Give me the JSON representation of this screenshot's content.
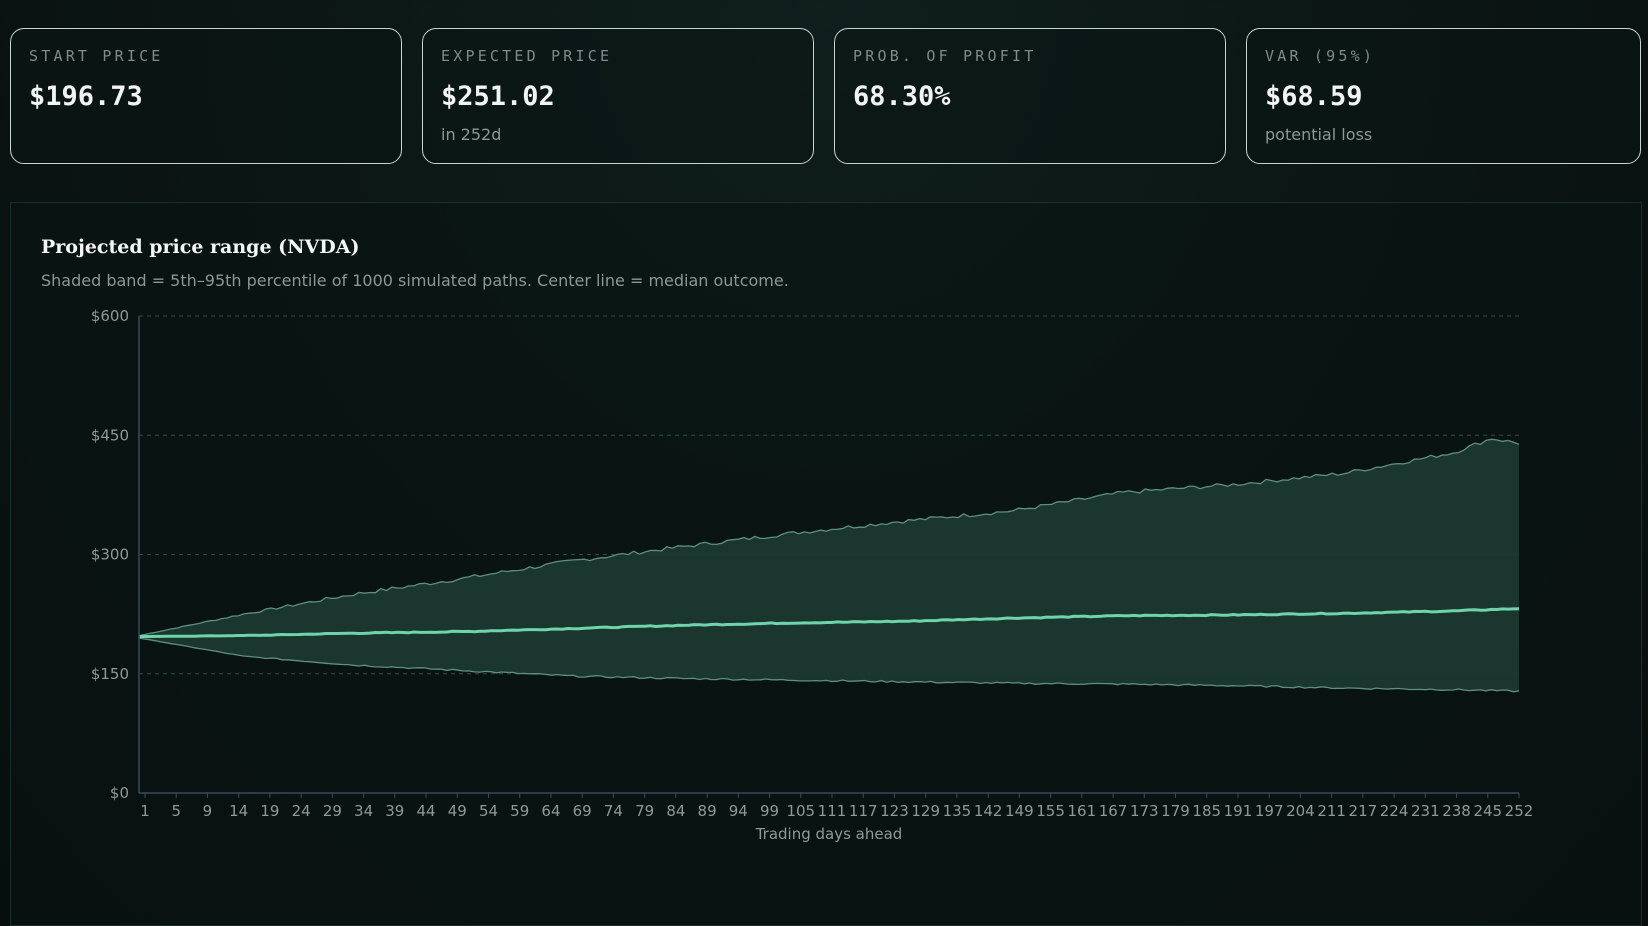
{
  "stats": [
    {
      "label": "START PRICE",
      "value": "$196.73",
      "sub": ""
    },
    {
      "label": "EXPECTED PRICE",
      "value": "$251.02",
      "sub": "in 252d"
    },
    {
      "label": "PROB. OF PROFIT",
      "value": "68.30%",
      "sub": ""
    },
    {
      "label": "VAR (95%)",
      "value": "$68.59",
      "sub": "potential loss"
    }
  ],
  "colors": {
    "band_fill": "#1c3a32",
    "band_edge": "#5e8f80",
    "median": "#6fd3ac",
    "grid": "#2e4a50",
    "axis": "#3a4a5a"
  },
  "chart_data": {
    "type": "area",
    "title": "Projected price range (NVDA)",
    "subtitle": "Shaded band = 5th–95th percentile of 1000 simulated paths. Center line = median outcome.",
    "xlabel": "Trading days ahead",
    "ylabel": "",
    "ylim": [
      0,
      600
    ],
    "y_ticks": [
      0,
      150,
      300,
      450,
      600
    ],
    "y_tick_labels": [
      "$0",
      "$150",
      "$300",
      "$450",
      "$600"
    ],
    "x_tick_labels": [
      "1",
      "5",
      "9",
      "14",
      "19",
      "24",
      "29",
      "34",
      "39",
      "44",
      "49",
      "54",
      "59",
      "64",
      "69",
      "74",
      "79",
      "84",
      "89",
      "94",
      "99",
      "105",
      "111",
      "117",
      "123",
      "129",
      "135",
      "142",
      "149",
      "155",
      "161",
      "167",
      "173",
      "179",
      "185",
      "191",
      "197",
      "204",
      "211",
      "217",
      "224",
      "231",
      "238",
      "245",
      "252"
    ],
    "xlim": [
      1,
      252
    ],
    "grid": true,
    "series": [
      {
        "name": "95th percentile",
        "x": [
          1,
          20,
          40,
          60,
          80,
          100,
          120,
          140,
          160,
          180,
          200,
          220,
          240,
          247,
          252
        ],
        "values": [
          198,
          225,
          250,
          270,
          292,
          310,
          327,
          342,
          355,
          378,
          388,
          402,
          428,
          446,
          440
        ]
      },
      {
        "name": "median",
        "x": [
          1,
          20,
          40,
          60,
          80,
          100,
          120,
          140,
          160,
          180,
          200,
          220,
          240,
          252
        ],
        "values": [
          196.73,
          198,
          201,
          203,
          207,
          211,
          214,
          216,
          220,
          223,
          224,
          226,
          229,
          232
        ]
      },
      {
        "name": "5th percentile",
        "x": [
          1,
          20,
          40,
          60,
          80,
          100,
          120,
          140,
          160,
          180,
          200,
          220,
          240,
          252
        ],
        "values": [
          195,
          172,
          161,
          154,
          147,
          144,
          142,
          140,
          138,
          137,
          135,
          132,
          130,
          128
        ]
      }
    ]
  }
}
